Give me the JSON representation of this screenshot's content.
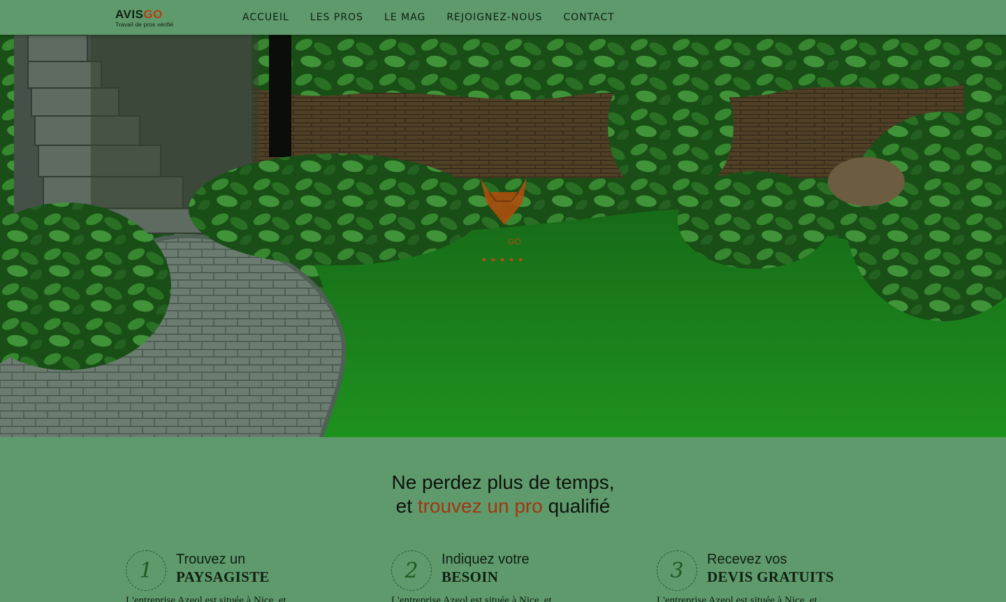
{
  "header": {
    "logo": {
      "brand_main": "AVIS",
      "brand_accent": "GO",
      "tagline": "Travail de pros vérifié"
    },
    "nav": [
      "ACCUEIL",
      "LES PROS",
      "LE MAG",
      "REJOIGNEZ-NOUS",
      "CONTACT"
    ]
  },
  "hero": {
    "watermark_text": "GO",
    "image_subject": "garden with lawn, curved paver path, stone steps and hostas"
  },
  "tagline": {
    "line1": "Ne perdez plus de temps,",
    "line2_start": "et",
    "line2_highlight": "trouvez un pro",
    "line2_end": "qualifié"
  },
  "steps": [
    {
      "number": "1",
      "title_small": "Trouvez un",
      "title_big": "PAYSAGISTE",
      "desc": "L'entreprise Azeol est située à Nice, et"
    },
    {
      "number": "2",
      "title_small": "Indiquez votre",
      "title_big": "BESOIN",
      "desc": "L'entreprise Azeol est située à Nice, et"
    },
    {
      "number": "3",
      "title_small": "Recevez vos",
      "title_big": "DEVIS GRATUITS",
      "desc": "L'entreprise Azeol est située à Nice, et"
    }
  ],
  "colors": {
    "page_bg": "#5f9a6c",
    "accent": "#a2350f",
    "step_circle": "#1c5c22"
  }
}
